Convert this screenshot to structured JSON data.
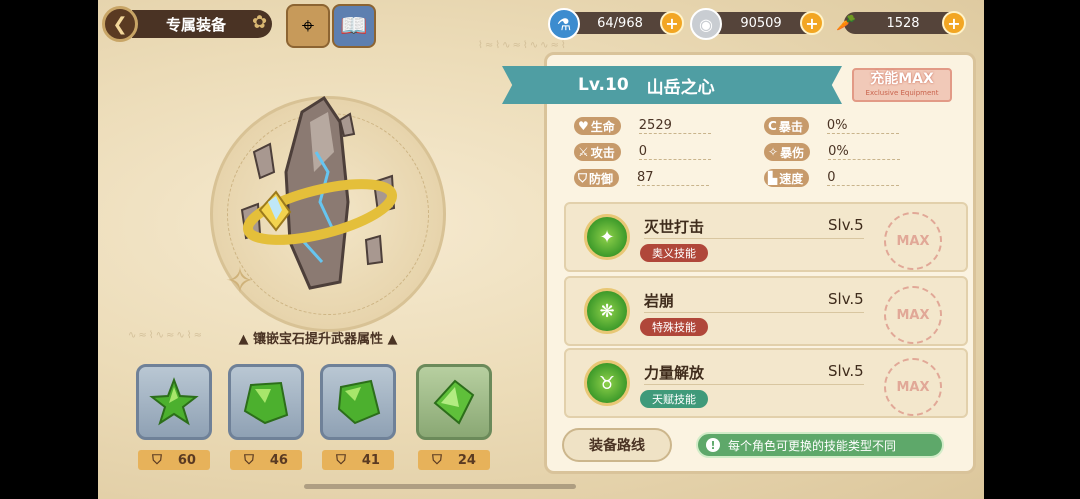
{
  "header": {
    "title": "专属装备",
    "resources": [
      {
        "name": "stamina",
        "value": "64/968",
        "icon": "potion-icon"
      },
      {
        "name": "silver",
        "value": "90509",
        "icon": "coin-icon"
      },
      {
        "name": "carrot",
        "value": "1528",
        "icon": "carrot-icon"
      }
    ]
  },
  "equipment": {
    "level": "Lv.10",
    "name": "山岳之心",
    "charge": {
      "title": "充能MAX",
      "subtitle": "Exclusive Equipment"
    },
    "gem_caption": "镶嵌宝石提升武器属性",
    "gems": [
      {
        "value": "60"
      },
      {
        "value": "46"
      },
      {
        "value": "41"
      },
      {
        "value": "24"
      }
    ]
  },
  "stats": [
    {
      "label": "生命",
      "value": "2529",
      "icon": "heart-icon"
    },
    {
      "label": "暴击",
      "value": "0%",
      "icon": "crit-icon"
    },
    {
      "label": "攻击",
      "value": "0",
      "icon": "sword-icon"
    },
    {
      "label": "暴伤",
      "value": "0%",
      "icon": "crit-damage-icon"
    },
    {
      "label": "防御",
      "value": "87",
      "icon": "shield-icon"
    },
    {
      "label": "速度",
      "value": "0",
      "icon": "boot-icon"
    }
  ],
  "skills": [
    {
      "name": "灭世打击",
      "level": "Slv.5",
      "tag": "奥义技能",
      "tag_color": "#b0473a",
      "stamp": "MAX"
    },
    {
      "name": "岩崩",
      "level": "Slv.5",
      "tag": "特殊技能",
      "tag_color": "#b0473a",
      "stamp": "MAX"
    },
    {
      "name": "力量解放",
      "level": "Slv.5",
      "tag": "天赋技能",
      "tag_color": "#3f9a7a",
      "stamp": "MAX"
    }
  ],
  "footer": {
    "route_button": "装备路线",
    "info_text": "每个角色可更换的技能类型不同"
  }
}
